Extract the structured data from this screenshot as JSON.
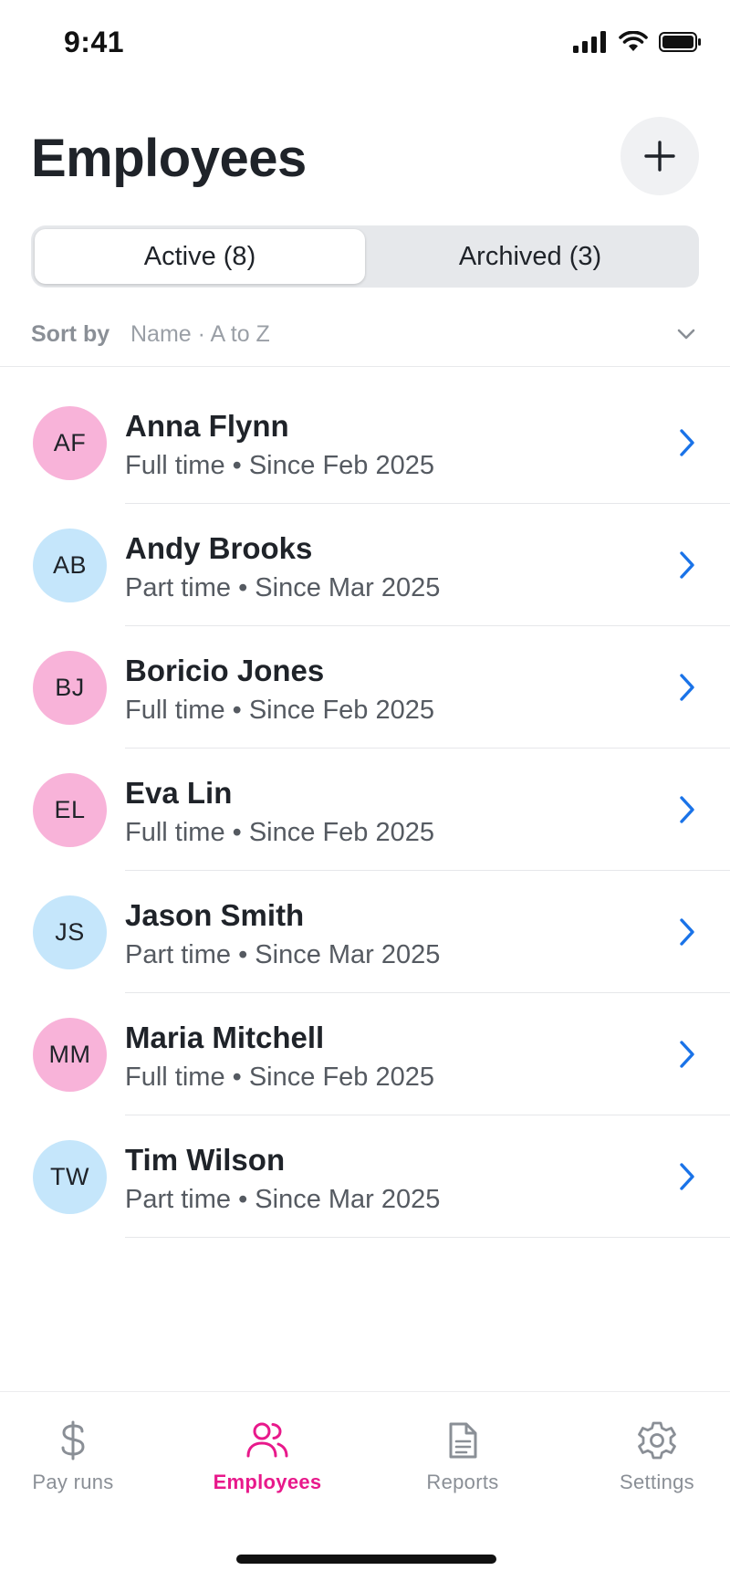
{
  "status_bar": {
    "time": "9:41"
  },
  "header": {
    "title": "Employees",
    "add_icon": "plus-icon"
  },
  "segments": [
    {
      "label": "Active (8)",
      "active": true
    },
    {
      "label": "Archived (3)",
      "active": false
    }
  ],
  "sort": {
    "label": "Sort by",
    "value": "Name · A to Z"
  },
  "employees": [
    {
      "initials": "AF",
      "name": "Anna Flynn",
      "meta": "Full time • Since Feb 2025",
      "avatar_color": "#f8b3d9"
    },
    {
      "initials": "AB",
      "name": "Andy Brooks",
      "meta": "Part time • Since Mar 2025",
      "avatar_color": "#c5e6fb"
    },
    {
      "initials": "BJ",
      "name": "Boricio Jones",
      "meta": "Full time • Since Feb 2025",
      "avatar_color": "#f8b3d9"
    },
    {
      "initials": "EL",
      "name": "Eva Lin",
      "meta": "Full time • Since Feb 2025",
      "avatar_color": "#f8b3d9"
    },
    {
      "initials": "JS",
      "name": "Jason Smith",
      "meta": "Part time • Since Mar 2025",
      "avatar_color": "#c5e6fb"
    },
    {
      "initials": "MM",
      "name": "Maria Mitchell",
      "meta": "Full time • Since Feb 2025",
      "avatar_color": "#f8b3d9"
    },
    {
      "initials": "TW",
      "name": "Tim Wilson",
      "meta": "Part time • Since Mar 2025",
      "avatar_color": "#c5e6fb"
    }
  ],
  "tabs": [
    {
      "label": "Pay runs",
      "icon": "dollar-icon",
      "active": false
    },
    {
      "label": "Employees",
      "icon": "users-icon",
      "active": true
    },
    {
      "label": "Reports",
      "icon": "document-icon",
      "active": false
    },
    {
      "label": "Settings",
      "icon": "gear-icon",
      "active": false
    }
  ],
  "colors": {
    "accent": "#e8198b",
    "chevron": "#1a73e8",
    "avatar_pink": "#f8b3d9",
    "avatar_blue": "#c5e6fb"
  }
}
